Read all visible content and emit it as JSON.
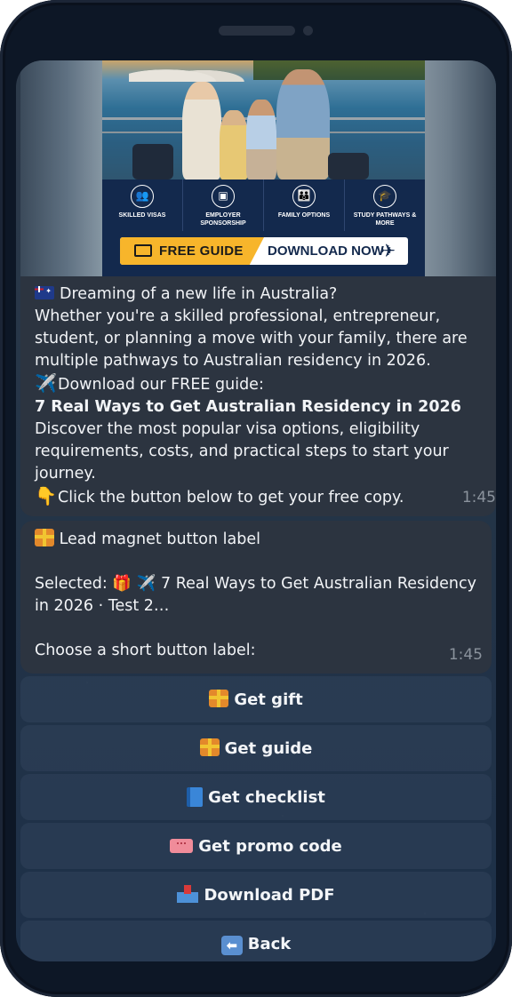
{
  "banner": {
    "features": [
      {
        "icon": "people-icon",
        "label": "SKILLED VISAS"
      },
      {
        "icon": "briefcase-icon",
        "label": "EMPLOYER SPONSORSHIP"
      },
      {
        "icon": "family-icon",
        "label": "FAMILY OPTIONS"
      },
      {
        "icon": "graduation-cap-icon",
        "label": "STUDY PATHWAYS & MORE"
      }
    ],
    "cta_free": "FREE GUIDE",
    "cta_download": "DOWNLOAD NOW"
  },
  "message1": {
    "line1": "Dreaming of a new life in Australia?",
    "line2": "Whether you're a skilled professional, entrepreneur, student, or planning a move with your family, there are multiple pathways to Australian residency in 2026.",
    "line3_emoji": "✈️",
    "line3": "Download our FREE guide:",
    "title": "7 Real Ways to Get Australian Residency in 2026",
    "line4": "Discover the most popular visa options, eligibility requirements, costs, and practical steps to start your journey.",
    "line5_emoji": "👇",
    "line5": "Click the button below to get your free copy.",
    "time": "1:45"
  },
  "message2": {
    "heading": "Lead magnet button label",
    "selected": "Selected: 🎁 ✈️ 7 Real Ways to Get Australian Residency in 2026 · Test 2…",
    "prompt": "Choose a short button label:",
    "time": "1:45"
  },
  "keyboard": [
    {
      "label": "Get gift",
      "icon": "gift-icon"
    },
    {
      "label": "Get guide",
      "icon": "gift-icon"
    },
    {
      "label": "Get checklist",
      "icon": "book-icon"
    },
    {
      "label": "Get promo code",
      "icon": "ticket-icon"
    },
    {
      "label": "Download PDF",
      "icon": "inbox-tray-icon"
    },
    {
      "label": "Back",
      "icon": "back-arrow-icon"
    }
  ]
}
